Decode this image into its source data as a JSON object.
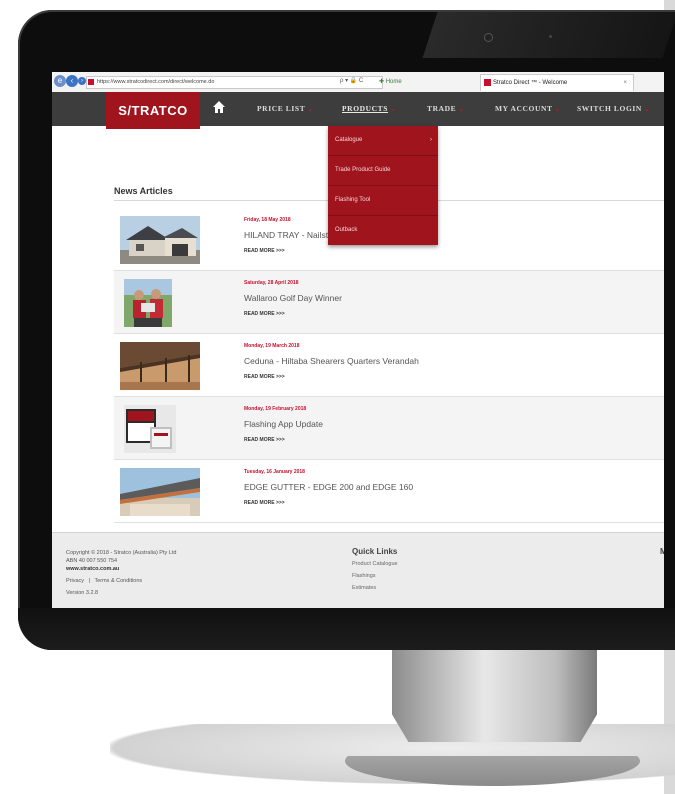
{
  "browser": {
    "url": "https://www.stratcodirect.com/direct/welcome.do",
    "tools": "ρ ▾ 🔒 C",
    "home_tab": "Home",
    "tab_title": "Stratco Direct ™ - Welcome",
    "tab_close": "×"
  },
  "header": {
    "logo": "S/TRATCO",
    "nav": [
      {
        "label": "PRICE LIST",
        "caret": "⌄"
      },
      {
        "label": "PRODUCTS",
        "caret": "⌄"
      },
      {
        "label": "TRADE",
        "caret": "⌄"
      },
      {
        "label": "MY ACCOUNT",
        "caret": "⌄"
      },
      {
        "label": "SWITCH LOGIN",
        "caret": "⌄"
      }
    ]
  },
  "products_menu": [
    {
      "label": "Catalogue",
      "arrow": "›"
    },
    {
      "label": "Trade Product Guide"
    },
    {
      "label": "Flashing Tool"
    },
    {
      "label": "Outback"
    }
  ],
  "news": {
    "title": "News Articles",
    "read_more": "READ MORE >>>",
    "articles": [
      {
        "date": "Friday, 18 May 2018",
        "title": "HILAND TRAY - Nailstrip (GrandStand)"
      },
      {
        "date": "Saturday, 28 April 2018",
        "title": "Wallaroo Golf Day Winner"
      },
      {
        "date": "Monday, 19 March 2018",
        "title": "Ceduna - Hiltaba Shearers Quarters Verandah"
      },
      {
        "date": "Monday, 19 February 2018",
        "title": "Flashing App Update"
      },
      {
        "date": "Tuesday, 16 January 2018",
        "title": "EDGE GUTTER - EDGE 200 and EDGE 160"
      }
    ]
  },
  "footer": {
    "copyright": "Copyright © 2018 - Stratco (Australia) Pty Ltd",
    "abn": "ABN 40 007 550 754",
    "site": "www.stratco.com.au",
    "privacy": "Privacy",
    "sep": "|",
    "terms": "Terms & Conditions",
    "version": "Version 3.2.8",
    "quick_links_title": "Quick Links",
    "quick_links": [
      "Product Catalogue",
      "Flashings",
      "Estimates"
    ],
    "right_heading": "M"
  },
  "colors": {
    "brand_red": "#a0141e",
    "nav_bg": "#3d3d3d",
    "date_red": "#c8102e"
  }
}
